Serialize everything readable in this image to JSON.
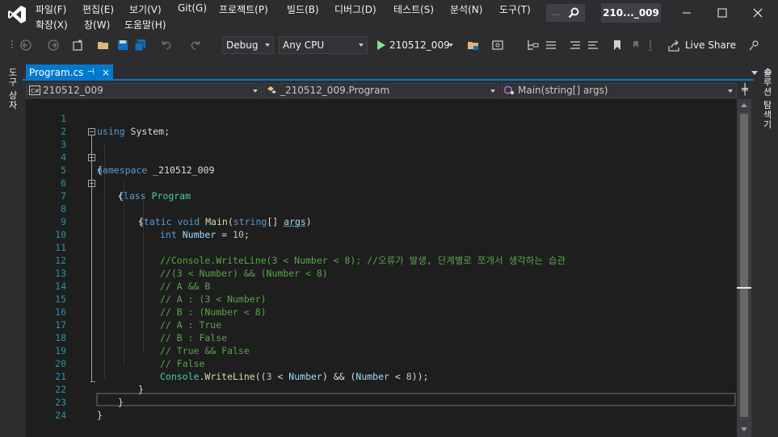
{
  "menu": {
    "row1": [
      "파일(F)",
      "편집(E)",
      "보기(V)",
      "Git(G)",
      "프로젝트(P)",
      "빌드(B)",
      "디버그(D)",
      "테스트(S)",
      "분석(N)",
      "도구(T)"
    ],
    "row2": [
      "확장(X)",
      "창(W)",
      "도움말(H)"
    ]
  },
  "search": {
    "dots": "..."
  },
  "window": {
    "solution_title": "210..._009"
  },
  "toolbar": {
    "configuration": "Debug",
    "platform": "Any CPU",
    "start_label": "210512_009",
    "live_share": "Live Share"
  },
  "side": {
    "left_label": "도구 상자",
    "right_label": "솔루션 탐색기"
  },
  "tab": {
    "label": "Program.cs",
    "pin": "⊣",
    "close": "×"
  },
  "nav": {
    "project": "210512_009",
    "class": "_210512_009.Program",
    "member": "Main(string[] args)"
  },
  "code": {
    "line_numbers": [
      "1",
      "2",
      "3",
      "4",
      "5",
      "6",
      "7",
      "8",
      "9",
      "10",
      "11",
      "12",
      "13",
      "14",
      "15",
      "16",
      "17",
      "18",
      "19",
      "20",
      "21",
      "22",
      "23",
      "24"
    ],
    "l1": {
      "kw": "using",
      "rest": " System;"
    },
    "l3": {
      "kw": "namespace",
      "rest": " _210512_009"
    },
    "l4": "{",
    "l5": {
      "kw": "class",
      "name": "Program"
    },
    "l6": "{",
    "l7": {
      "kw1": "static",
      "kw2": "void",
      "fn": "Main",
      "open": "(",
      "kw3": "string",
      "mid": "[] ",
      "param": "args",
      "close": ")"
    },
    "l8": "{",
    "l9": {
      "kw": "int",
      "var": "Number",
      "eq": " = ",
      "num": "10",
      "end": ";"
    },
    "comments": [
      "//Console.WriteLine(3 < Number < 8); //오류가 발생, 단계별로 쪼개서 생각하는 습관",
      "//(3 < Number) && (Number < 8)",
      "// A && B",
      "// A : (3 < Number)",
      "// B : (Number < 8)",
      "// A : True",
      "// B : False",
      "// True && False",
      "// False"
    ],
    "l20": {
      "obj": "Console",
      "dot": ".",
      "fn": "WriteLine",
      "a": "((",
      "n1": "3",
      "b": " < ",
      "v1": "Number",
      "c": ") && (",
      "v2": "Number",
      "d": " < ",
      "n2": "8",
      "e": "));"
    },
    "l21": "}",
    "l22": "}",
    "l23": "}"
  },
  "colors": {
    "accent": "#007acc",
    "keyword": "#569cd6",
    "type": "#4ec9b0",
    "method": "#dcdcaa",
    "comment": "#57a64a",
    "number": "#b5cea8",
    "line_number": "#2b91af"
  }
}
